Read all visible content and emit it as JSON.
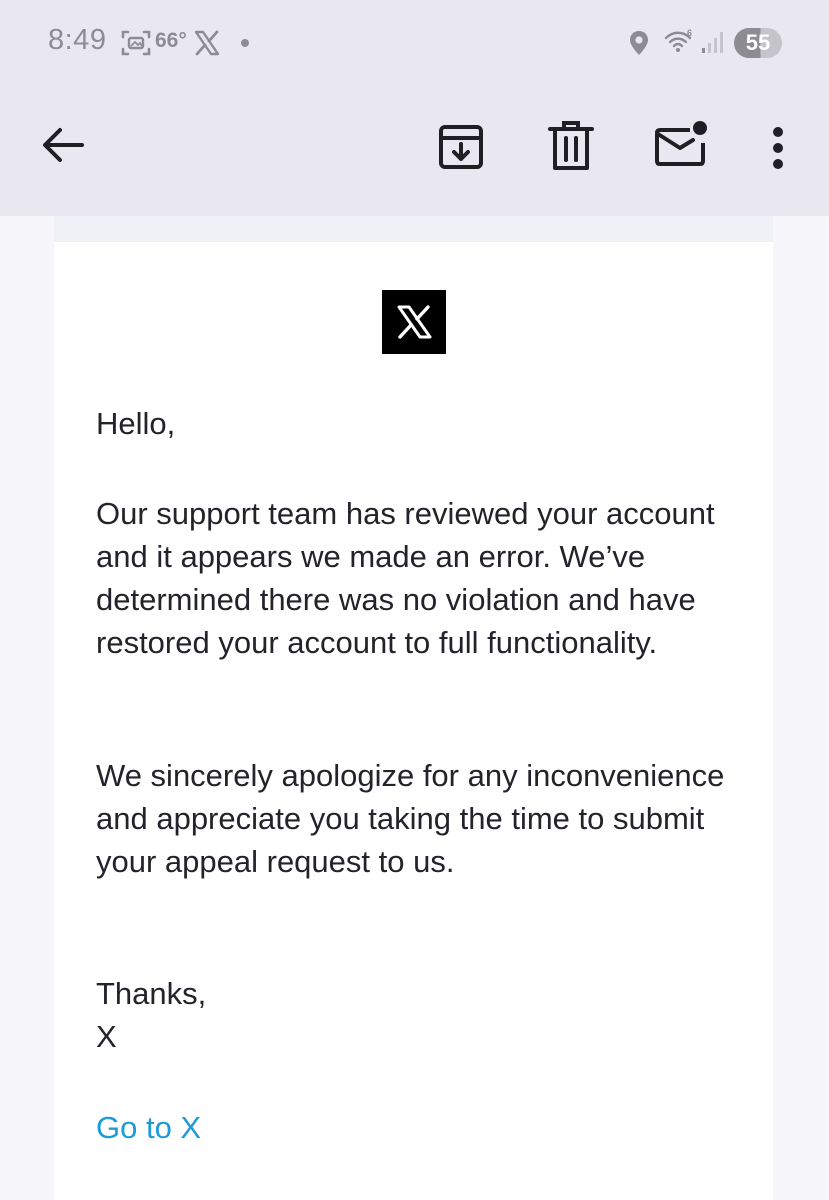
{
  "status_bar": {
    "time": "8:49",
    "weather": "66°",
    "battery": "55",
    "icons": [
      "gallery-icon",
      "x-app-icon",
      "notification-dot-icon",
      "location-icon",
      "wifi-icon",
      "signal-icon",
      "battery-icon"
    ]
  },
  "toolbar": {
    "icons": [
      "back-arrow-icon",
      "archive-icon",
      "delete-icon",
      "mark-unread-icon",
      "more-vert-icon"
    ]
  },
  "email": {
    "logo_icon": "x-logo-icon",
    "greeting": "Hello,",
    "paragraph_1": "Our support team has reviewed your account and it appears we made an error. We’ve determined there was no violation and have restored your account to full functionality.",
    "paragraph_2": "We sincerely apologize for any inconvenience and appreciate you taking the time to submit your appeal request to us.",
    "closing": "Thanks,",
    "signature": "X",
    "link_label": "Go to X"
  },
  "colors": {
    "chrome_background": "#e9e8f0",
    "status_icon": "#8d8c93",
    "toolbar_icon": "#1f1f24",
    "body_text": "#23232b",
    "link": "#1d9bd9",
    "card_background": "#ffffff"
  }
}
